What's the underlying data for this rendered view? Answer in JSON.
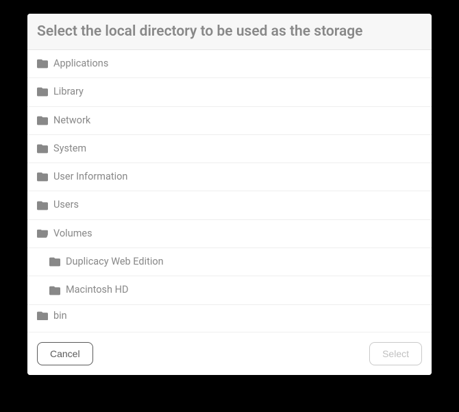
{
  "dialog": {
    "title": "Select the local directory to be used as the storage"
  },
  "tree": {
    "items": [
      {
        "label": "Applications",
        "open": false,
        "depth": 0
      },
      {
        "label": "Library",
        "open": false,
        "depth": 0
      },
      {
        "label": "Network",
        "open": false,
        "depth": 0
      },
      {
        "label": "System",
        "open": false,
        "depth": 0
      },
      {
        "label": "User Information",
        "open": false,
        "depth": 0
      },
      {
        "label": "Users",
        "open": false,
        "depth": 0
      },
      {
        "label": "Volumes",
        "open": true,
        "depth": 0
      },
      {
        "label": "Duplicacy Web Edition",
        "open": false,
        "depth": 1
      },
      {
        "label": "Macintosh HD",
        "open": false,
        "depth": 1
      },
      {
        "label": "bin",
        "open": false,
        "depth": 0
      }
    ]
  },
  "buttons": {
    "cancel": "Cancel",
    "select": "Select"
  }
}
